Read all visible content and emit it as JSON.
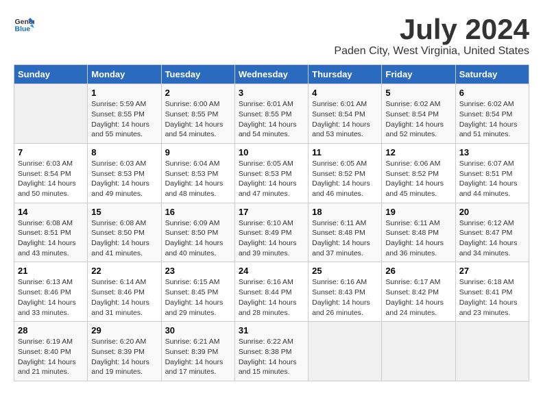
{
  "logo": {
    "general": "General",
    "blue": "Blue"
  },
  "title": "July 2024",
  "subtitle": "Paden City, West Virginia, United States",
  "days_header": [
    "Sunday",
    "Monday",
    "Tuesday",
    "Wednesday",
    "Thursday",
    "Friday",
    "Saturday"
  ],
  "weeks": [
    [
      {
        "day": "",
        "info": ""
      },
      {
        "day": "1",
        "info": "Sunrise: 5:59 AM\nSunset: 8:55 PM\nDaylight: 14 hours\nand 55 minutes."
      },
      {
        "day": "2",
        "info": "Sunrise: 6:00 AM\nSunset: 8:55 PM\nDaylight: 14 hours\nand 54 minutes."
      },
      {
        "day": "3",
        "info": "Sunrise: 6:01 AM\nSunset: 8:55 PM\nDaylight: 14 hours\nand 54 minutes."
      },
      {
        "day": "4",
        "info": "Sunrise: 6:01 AM\nSunset: 8:54 PM\nDaylight: 14 hours\nand 53 minutes."
      },
      {
        "day": "5",
        "info": "Sunrise: 6:02 AM\nSunset: 8:54 PM\nDaylight: 14 hours\nand 52 minutes."
      },
      {
        "day": "6",
        "info": "Sunrise: 6:02 AM\nSunset: 8:54 PM\nDaylight: 14 hours\nand 51 minutes."
      }
    ],
    [
      {
        "day": "7",
        "info": "Sunrise: 6:03 AM\nSunset: 8:54 PM\nDaylight: 14 hours\nand 50 minutes."
      },
      {
        "day": "8",
        "info": "Sunrise: 6:03 AM\nSunset: 8:53 PM\nDaylight: 14 hours\nand 49 minutes."
      },
      {
        "day": "9",
        "info": "Sunrise: 6:04 AM\nSunset: 8:53 PM\nDaylight: 14 hours\nand 48 minutes."
      },
      {
        "day": "10",
        "info": "Sunrise: 6:05 AM\nSunset: 8:53 PM\nDaylight: 14 hours\nand 47 minutes."
      },
      {
        "day": "11",
        "info": "Sunrise: 6:05 AM\nSunset: 8:52 PM\nDaylight: 14 hours\nand 46 minutes."
      },
      {
        "day": "12",
        "info": "Sunrise: 6:06 AM\nSunset: 8:52 PM\nDaylight: 14 hours\nand 45 minutes."
      },
      {
        "day": "13",
        "info": "Sunrise: 6:07 AM\nSunset: 8:51 PM\nDaylight: 14 hours\nand 44 minutes."
      }
    ],
    [
      {
        "day": "14",
        "info": "Sunrise: 6:08 AM\nSunset: 8:51 PM\nDaylight: 14 hours\nand 43 minutes."
      },
      {
        "day": "15",
        "info": "Sunrise: 6:08 AM\nSunset: 8:50 PM\nDaylight: 14 hours\nand 41 minutes."
      },
      {
        "day": "16",
        "info": "Sunrise: 6:09 AM\nSunset: 8:50 PM\nDaylight: 14 hours\nand 40 minutes."
      },
      {
        "day": "17",
        "info": "Sunrise: 6:10 AM\nSunset: 8:49 PM\nDaylight: 14 hours\nand 39 minutes."
      },
      {
        "day": "18",
        "info": "Sunrise: 6:11 AM\nSunset: 8:48 PM\nDaylight: 14 hours\nand 37 minutes."
      },
      {
        "day": "19",
        "info": "Sunrise: 6:11 AM\nSunset: 8:48 PM\nDaylight: 14 hours\nand 36 minutes."
      },
      {
        "day": "20",
        "info": "Sunrise: 6:12 AM\nSunset: 8:47 PM\nDaylight: 14 hours\nand 34 minutes."
      }
    ],
    [
      {
        "day": "21",
        "info": "Sunrise: 6:13 AM\nSunset: 8:46 PM\nDaylight: 14 hours\nand 33 minutes."
      },
      {
        "day": "22",
        "info": "Sunrise: 6:14 AM\nSunset: 8:46 PM\nDaylight: 14 hours\nand 31 minutes."
      },
      {
        "day": "23",
        "info": "Sunrise: 6:15 AM\nSunset: 8:45 PM\nDaylight: 14 hours\nand 29 minutes."
      },
      {
        "day": "24",
        "info": "Sunrise: 6:16 AM\nSunset: 8:44 PM\nDaylight: 14 hours\nand 28 minutes."
      },
      {
        "day": "25",
        "info": "Sunrise: 6:16 AM\nSunset: 8:43 PM\nDaylight: 14 hours\nand 26 minutes."
      },
      {
        "day": "26",
        "info": "Sunrise: 6:17 AM\nSunset: 8:42 PM\nDaylight: 14 hours\nand 24 minutes."
      },
      {
        "day": "27",
        "info": "Sunrise: 6:18 AM\nSunset: 8:41 PM\nDaylight: 14 hours\nand 23 minutes."
      }
    ],
    [
      {
        "day": "28",
        "info": "Sunrise: 6:19 AM\nSunset: 8:40 PM\nDaylight: 14 hours\nand 21 minutes."
      },
      {
        "day": "29",
        "info": "Sunrise: 6:20 AM\nSunset: 8:39 PM\nDaylight: 14 hours\nand 19 minutes."
      },
      {
        "day": "30",
        "info": "Sunrise: 6:21 AM\nSunset: 8:39 PM\nDaylight: 14 hours\nand 17 minutes."
      },
      {
        "day": "31",
        "info": "Sunrise: 6:22 AM\nSunset: 8:38 PM\nDaylight: 14 hours\nand 15 minutes."
      },
      {
        "day": "",
        "info": ""
      },
      {
        "day": "",
        "info": ""
      },
      {
        "day": "",
        "info": ""
      }
    ]
  ]
}
